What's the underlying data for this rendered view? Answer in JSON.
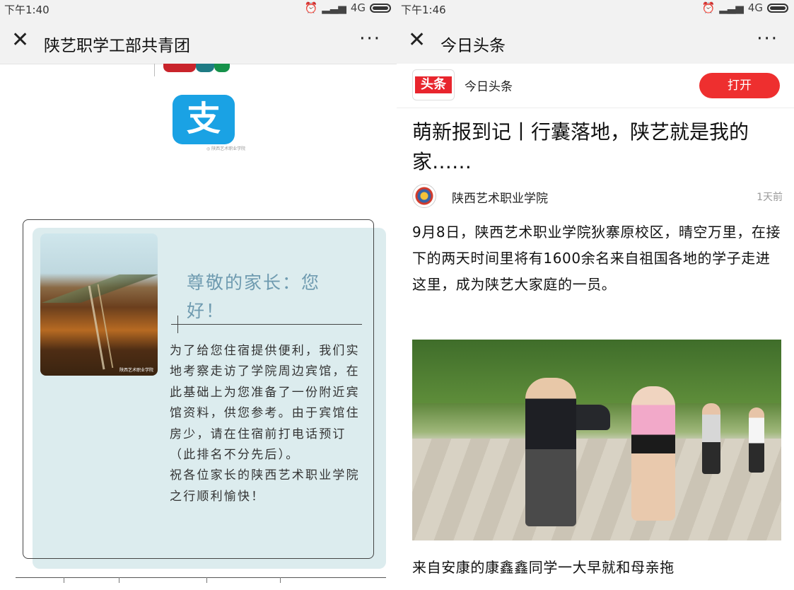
{
  "left": {
    "status": {
      "time": "下午1:40",
      "network": "4G"
    },
    "nav": {
      "close": "✕",
      "title": "陕艺职学工部共青团",
      "more": "···"
    },
    "alipay": {
      "glyph": "支",
      "caption": "◎ 陕西艺术职业学院"
    },
    "card": {
      "greeting": "尊敬的家长：您好！",
      "photo_watermark": "陕西艺术职业学院",
      "letter": "为了给您住宿提供便利，我们实地考察走访了学院周边宾馆，在此基础上为您准备了一份附近宾馆资料，供您参考。由于宾馆住房少，请在住宿前打电话预订（此排名不分先后）。",
      "wish": "祝各位家长的陕西艺术职业学院之行顺利愉快！"
    }
  },
  "right": {
    "status": {
      "time": "下午1:46",
      "network": "4G"
    },
    "nav": {
      "close": "✕",
      "title": "今日头条",
      "more": "···"
    },
    "app": {
      "logo_text": "头条",
      "name": "今日头条",
      "open_label": "打开"
    },
    "article": {
      "headline": "萌新报到记丨行囊落地，陕艺就是我的家……",
      "author": "陕西艺术职业学院",
      "time": "1天前",
      "paragraph": "9月8日，陕西艺术职业学院狄寨原校区，晴空万里，在接下的两天时间里将有1600余名来自祖国各地的学子走进这里，成为陕艺大家庭的一员。",
      "paragraph2": "来自安康的康鑫鑫同学一大早就和母亲拖"
    }
  }
}
